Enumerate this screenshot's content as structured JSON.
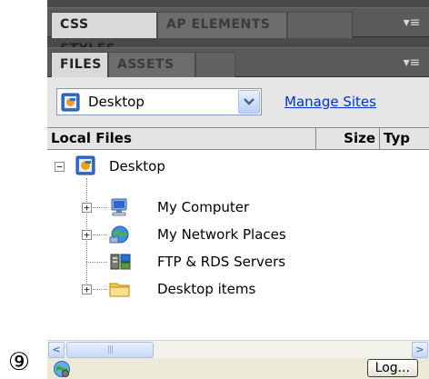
{
  "callout": "⑨",
  "tabs_top": [
    {
      "label": "CSS STYLES",
      "active": true
    },
    {
      "label": "AP ELEMENTS",
      "active": false
    }
  ],
  "tabs_second": [
    {
      "label": "FILES",
      "active": true
    },
    {
      "label": "ASSETS",
      "active": false
    }
  ],
  "panel_menu_icon": "panel-options-icon",
  "site_select": {
    "value": "Desktop",
    "icon": "site-icon"
  },
  "manage_sites": "Manage Sites",
  "columns": {
    "local": "Local Files",
    "size": "Size",
    "type": "Typ"
  },
  "tree": {
    "root": {
      "label": "Desktop",
      "expanded": true,
      "icon": "desktop-site-icon"
    },
    "children": [
      {
        "label": "My Computer",
        "expandable": true,
        "icon": "my-computer-icon"
      },
      {
        "label": "My Network Places",
        "expandable": true,
        "icon": "network-places-icon"
      },
      {
        "label": "FTP & RDS Servers",
        "expandable": false,
        "icon": "ftp-servers-icon"
      },
      {
        "label": "Desktop items",
        "expandable": true,
        "icon": "folder-icon"
      }
    ]
  },
  "scrollbar": {
    "left": "<",
    "right": ">",
    "thumb_grip": "|||"
  },
  "status": {
    "log_button": "Log..."
  }
}
